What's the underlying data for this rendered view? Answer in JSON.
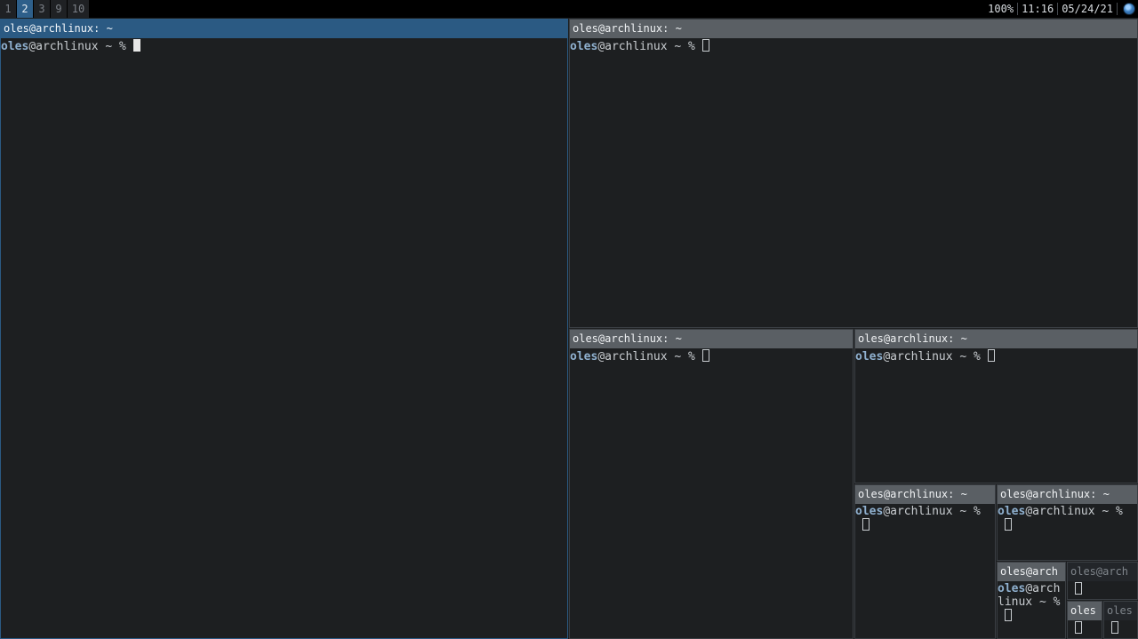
{
  "workspaces": [
    {
      "label": "1",
      "active": false
    },
    {
      "label": "2",
      "active": true
    },
    {
      "label": "3",
      "active": false
    },
    {
      "label": "9",
      "active": false
    },
    {
      "label": "10",
      "active": false
    }
  ],
  "status": {
    "volume": "100%",
    "time": "11:16",
    "date": "05/24/21",
    "tray_icon": "globe-icon"
  },
  "colors": {
    "focused_title": "#2b5a83",
    "unfocused_title": "#5a5f64",
    "terminal_bg": "#1d1f21",
    "prompt_user": "#8fb0cf"
  },
  "windows": [
    {
      "title": "oles@archlinux: ~",
      "user": "oles",
      "host_prompt": "@archlinux ~ % ",
      "focused": true
    },
    {
      "title": "oles@archlinux: ~",
      "user": "oles",
      "host_prompt": "@archlinux ~ % "
    },
    {
      "title": "oles@archlinux: ~",
      "user": "oles",
      "host_prompt": "@archlinux ~ % "
    },
    {
      "title": "oles@archlinux: ~",
      "user": "oles",
      "host_prompt": "@archlinux ~ % "
    },
    {
      "title": "oles@archlinux: ~",
      "user": "oles",
      "host_prompt": "@archlinux ~ % "
    },
    {
      "title": "oles@archlinux: ~",
      "user": "oles",
      "host_prompt": "@archlinux ~ % "
    },
    {
      "title": "oles@arch",
      "user": "oles",
      "host_prompt": "@archlinux ~ % "
    },
    {
      "title": "oles@arch",
      "user": "",
      "host_prompt": ""
    },
    {
      "title": "oles",
      "user": "",
      "host_prompt": ""
    },
    {
      "title": "oles",
      "user": "",
      "host_prompt": ""
    }
  ]
}
